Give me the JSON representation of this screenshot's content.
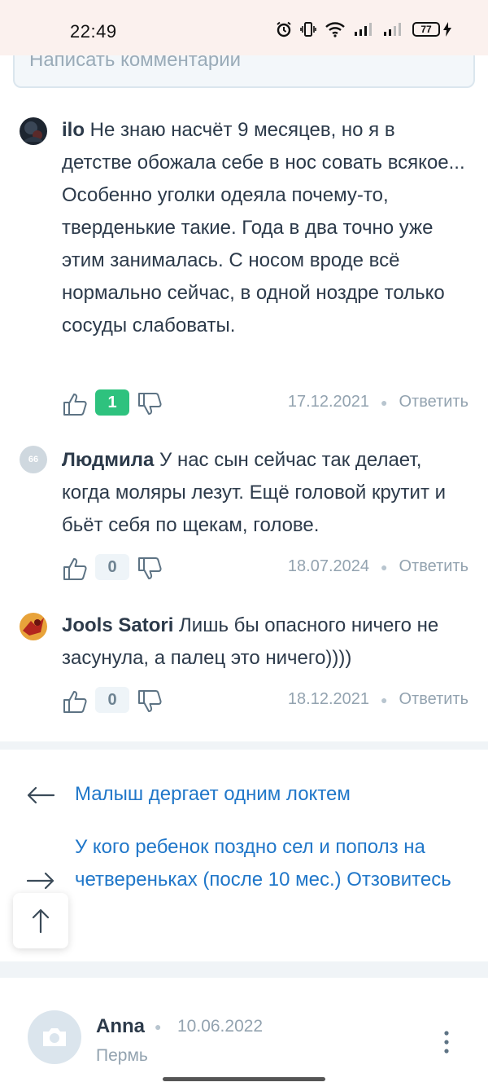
{
  "status_bar": {
    "time": "22:49",
    "battery": "77",
    "icons": [
      "alarm-icon",
      "vibrate-icon",
      "wifi-icon",
      "signal-icon",
      "signal-icon",
      "battery-icon",
      "charging-icon"
    ]
  },
  "comment_input": {
    "placeholder": "Написать комментарий"
  },
  "comments": [
    {
      "author": "ilo",
      "text": "Не знаю насчёт 9 месяцев, но я в детстве обожала себе в нос совать всякое... Особенно уголки одеяла почему-то, тверденькие такие. Года в два точно уже этим занималась. С носом вроде всё нормально сейчас, в одной ноздре только сосуды слабоваты.",
      "votes": "1",
      "date": "17.12.2021",
      "reply_label": "Ответить"
    },
    {
      "author": "Людмила",
      "avatar_initials": "66",
      "text": "У нас сын сейчас так делает, когда моляры лезут. Ещё головой крутит и бьёт себя по щекам, голове.",
      "votes": "0",
      "date": "18.07.2024",
      "reply_label": "Ответить"
    },
    {
      "author": "Jools Satori",
      "text": "Лишь бы опасного ничего не засунула, а палец это ничего))))",
      "votes": "0",
      "date": "18.12.2021",
      "reply_label": "Ответить"
    }
  ],
  "navigation": {
    "prev": "Малыш дергает одним локтем",
    "next": "У кого ребенок поздно сел и пополз на четвереньках (после 10 мес.) Отзовитесь"
  },
  "post": {
    "author": "Anna",
    "date": "10.06.2022",
    "city": "Пермь"
  },
  "colors": {
    "accent_link": "#2077c9",
    "positive_vote": "#2ec27e",
    "muted_text": "#93a3b0",
    "main_text": "#2c3a4a"
  }
}
